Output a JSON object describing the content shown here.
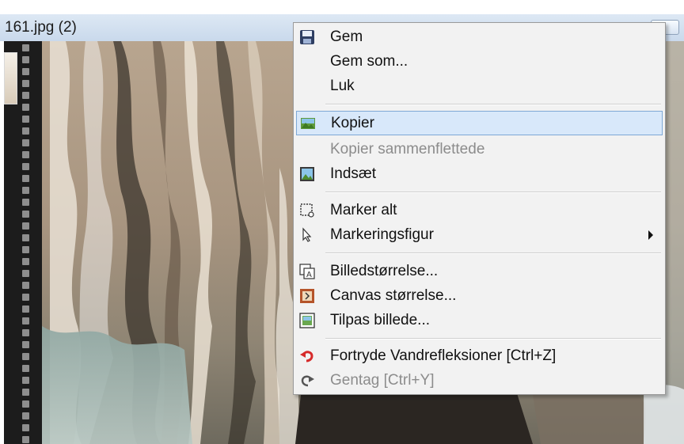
{
  "window": {
    "title": "161.jpg (2)"
  },
  "colors": {
    "menu_background": "#f2f2f2",
    "highlight": "#d8e8fa",
    "highlight_border": "#7ea8d6",
    "disabled_text": "#8c8c8c",
    "undo_icon": "#d62a2a"
  },
  "context_menu": {
    "items": [
      {
        "label": "Gem",
        "icon": "save-icon",
        "state": "normal"
      },
      {
        "label": "Gem som...",
        "icon": "",
        "state": "normal"
      },
      {
        "label": "Luk",
        "icon": "",
        "state": "normal"
      },
      {
        "label": "Kopier",
        "icon": "copy-image-icon",
        "state": "highlighted"
      },
      {
        "label": "Kopier sammenflettede",
        "icon": "",
        "state": "disabled"
      },
      {
        "label": "Indsæt",
        "icon": "paste-image-icon",
        "state": "normal"
      },
      {
        "label": "Marker alt",
        "icon": "select-all-icon",
        "state": "normal"
      },
      {
        "label": "Markeringsfigur",
        "icon": "pointer-icon",
        "state": "normal",
        "submenu": true
      },
      {
        "label": "Billedstørrelse...",
        "icon": "image-size-icon",
        "state": "normal"
      },
      {
        "label": "Canvas størrelse...",
        "icon": "canvas-size-icon",
        "state": "normal"
      },
      {
        "label": "Tilpas billede...",
        "icon": "fit-image-icon",
        "state": "normal"
      },
      {
        "label": "Fortryde Vandrefleksioner [Ctrl+Z]",
        "icon": "undo-icon",
        "state": "normal"
      },
      {
        "label": "Gentag [Ctrl+Y]",
        "icon": "redo-icon",
        "state": "disabled"
      }
    ]
  }
}
